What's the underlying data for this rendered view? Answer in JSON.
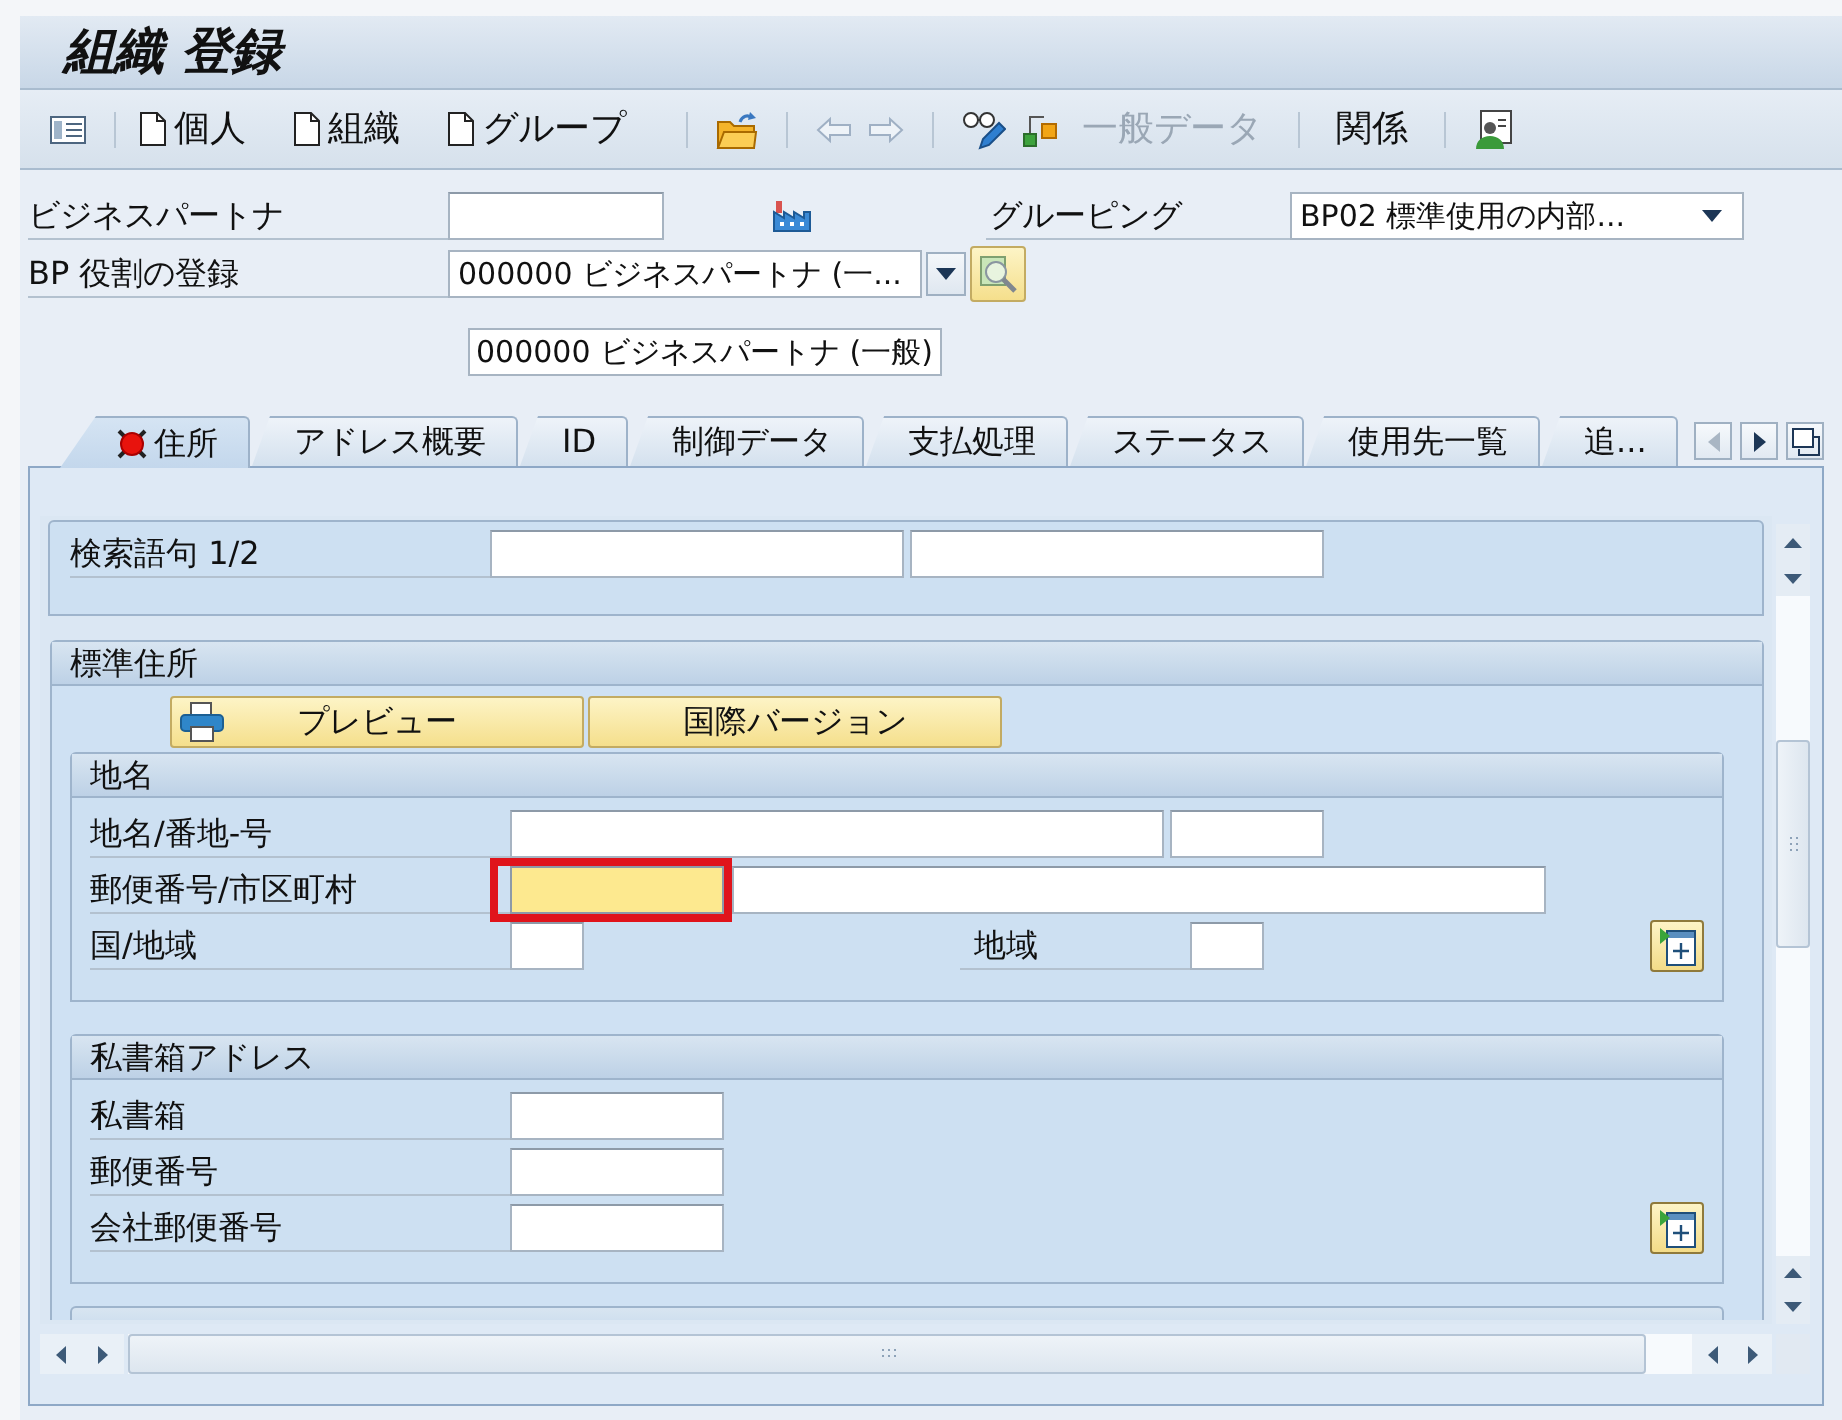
{
  "window": {
    "title": "組織 登録"
  },
  "toolbar": {
    "create_buttons": [
      {
        "label": "個人"
      },
      {
        "label": "組織"
      },
      {
        "label": "グループ"
      }
    ],
    "back": {
      "disabled": true
    },
    "forward": {
      "disabled": true
    },
    "view_buttons": [
      {
        "label": "一般データ",
        "disabled": true
      },
      {
        "label": "関係",
        "disabled": false
      }
    ]
  },
  "header": {
    "partner": {
      "label": "ビジネスパートナ"
    },
    "grouping": {
      "label": "グルーピング",
      "value": "BP02 標準使用の内部..."
    },
    "role": {
      "label": "BP 役割の登録",
      "value": "000000 ビジネスパートナ (一..."
    },
    "role_display": "000000 ビジネスパートナ (一般)"
  },
  "tabs": [
    {
      "label": "住所",
      "selected": true,
      "alert": true
    },
    {
      "label": "アドレス概要",
      "selected": false,
      "alert": false
    },
    {
      "label": "ID",
      "selected": false,
      "alert": false
    },
    {
      "label": "制御データ",
      "selected": false,
      "alert": false
    },
    {
      "label": "支払処理",
      "selected": false,
      "alert": false
    },
    {
      "label": "ステータス",
      "selected": false,
      "alert": false
    },
    {
      "label": "使用先一覧",
      "selected": false,
      "alert": false
    },
    {
      "label": "追...",
      "selected": false,
      "alert": false
    }
  ],
  "tab_scroll": {
    "left": {
      "disabled": true
    },
    "right": {
      "disabled": false
    }
  },
  "address_tab": {
    "search_terms": {
      "label": "検索語句 1/2",
      "fields": [
        {
          "focused": false,
          "highlighted": false
        },
        {
          "focused": false,
          "highlighted": false
        }
      ]
    },
    "standard_address": {
      "title": "標準住所",
      "buttons": [
        {
          "kind": "preview",
          "label": "プレビュー"
        },
        {
          "kind": "plain",
          "label": "国際バージョン"
        }
      ],
      "groups": [
        {
          "title": "地名",
          "rows": [
            {
              "label": "地名/番地-号",
              "fields": [
                {
                  "focused": false,
                  "highlighted": false
                },
                {
                  "focused": false,
                  "highlighted": false
                }
              ]
            },
            {
              "label": "郵便番号/市区町村",
              "fields": [
                {
                  "focused": true,
                  "highlighted": true
                },
                {
                  "focused": false,
                  "highlighted": false
                }
              ]
            },
            {
              "label": "国/地域",
              "fields": [
                {
                  "focused": false,
                  "highlighted": false
                }
              ],
              "secondary": {
                "label": "地域",
                "fields": [
                  {
                    "focused": false,
                    "highlighted": false
                  }
                ]
              }
            }
          ]
        },
        {
          "title": "私書箱アドレス",
          "rows": [
            {
              "label": "私書箱",
              "fields": [
                {
                  "focused": false,
                  "highlighted": false
                }
              ]
            },
            {
              "label": "郵便番号",
              "fields": [
                {
                  "focused": false,
                  "highlighted": false
                }
              ]
            },
            {
              "label": "会社郵便番号",
              "fields": [
                {
                  "focused": false,
                  "highlighted": false
                }
              ]
            }
          ]
        }
      ]
    }
  }
}
